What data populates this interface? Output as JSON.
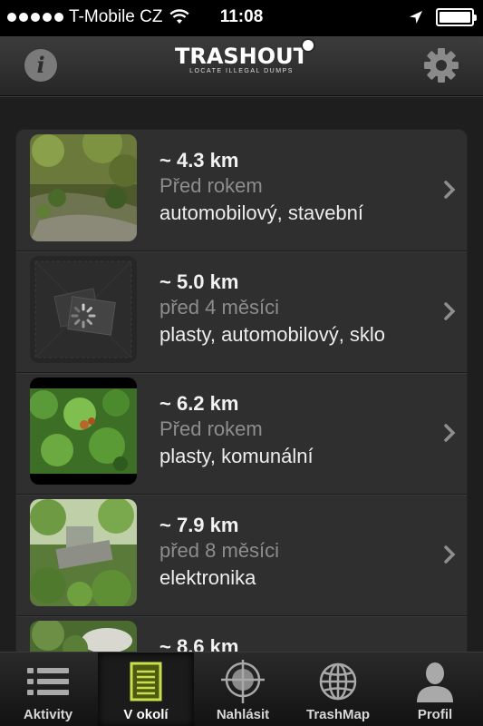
{
  "status_bar": {
    "carrier": "T-Mobile CZ",
    "time": "11:08",
    "signal_icon": "signal-dots-icon",
    "wifi_icon": "wifi-icon",
    "location_icon": "location-arrow-icon",
    "battery_icon": "battery-icon",
    "battery_level": 1.0
  },
  "nav_bar": {
    "logo_text": "TRASHOUT",
    "logo_tagline": "LOCATE ILLEGAL DUMPS",
    "info_icon": "info-icon",
    "info_glyph": "i",
    "settings_icon": "gear-icon"
  },
  "dumps": [
    {
      "distance": "~ 4.3 km",
      "age": "Před rokem",
      "types": "automobilový, stavební",
      "thumb": "forest-path"
    },
    {
      "distance": "~ 5.0 km",
      "age": "před 4 měsíci",
      "types": "plasty, automobilový, sklo",
      "thumb": "loading-placeholder"
    },
    {
      "distance": "~ 6.2 km",
      "age": "Před rokem",
      "types": "plasty, komunální",
      "thumb": "green-leaves"
    },
    {
      "distance": "~ 7.9 km",
      "age": "před 8 měsíci",
      "types": "elektronika",
      "thumb": "trees-debris"
    },
    {
      "distance": "~ 8.6 km",
      "age": "",
      "types": "",
      "thumb": "trees-bag"
    }
  ],
  "tabs": [
    {
      "label": "Aktivity",
      "icon": "list-icon",
      "active": false
    },
    {
      "label": "V okolí",
      "icon": "notepad-icon",
      "active": true
    },
    {
      "label": "Nahlásit",
      "icon": "pin-target-icon",
      "active": false
    },
    {
      "label": "TrashMap",
      "icon": "globe-icon",
      "active": false
    },
    {
      "label": "Profil",
      "icon": "person-icon",
      "active": false
    }
  ],
  "colors": {
    "background": "#1e1e1e",
    "card": "#2f2f2f",
    "secondary_text": "#8d8d8d",
    "primary_text": "#f2f2f2"
  }
}
